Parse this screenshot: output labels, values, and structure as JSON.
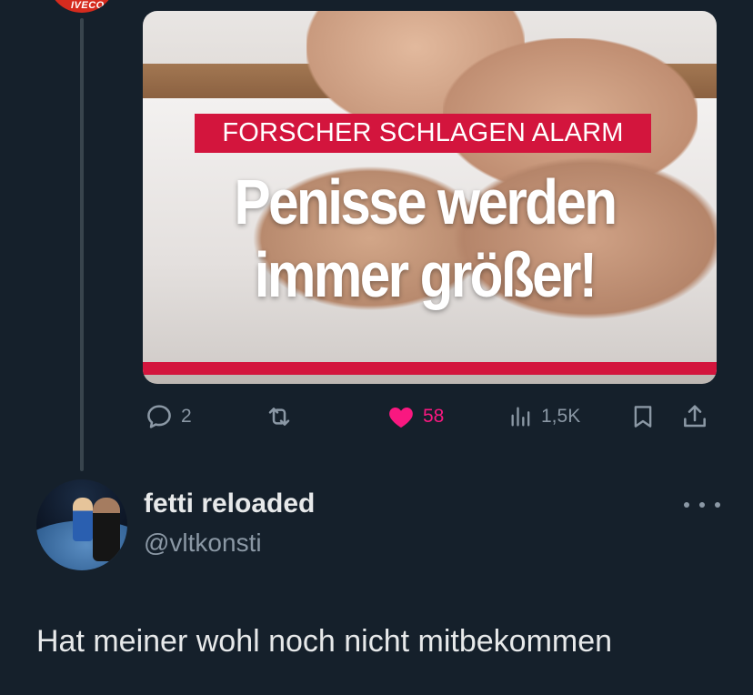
{
  "top_avatar": {
    "label": "IVECO",
    "brand_color": "#d52b1e"
  },
  "media": {
    "kicker": "FORSCHER SCHLAGEN ALARM",
    "headline_line1": "Penisse werden",
    "headline_line2": "immer größer!",
    "accent_color": "#d3153d"
  },
  "actions": {
    "reply_count": "2",
    "like_count": "58",
    "view_count": "1,5K",
    "like_color": "#f91880"
  },
  "reply": {
    "display_name": "fetti reloaded",
    "handle": "@vltkonsti",
    "text": "Hat meiner wohl noch nicht mitbekommen"
  }
}
